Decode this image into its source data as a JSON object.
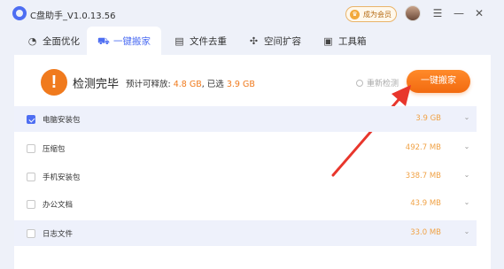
{
  "app": {
    "title": "C盘助手_V1.0.13.56",
    "vip_label": "成为会员"
  },
  "window_controls": {
    "menu_icon": "menu-icon",
    "minimize_icon": "minimize-icon",
    "close_icon": "close-icon"
  },
  "tabs": [
    {
      "label": "全面优化",
      "icon": "gauge-icon",
      "active": false
    },
    {
      "label": "一键搬家",
      "icon": "truck-icon",
      "active": true
    },
    {
      "label": "文件去重",
      "icon": "file-icon",
      "active": false
    },
    {
      "label": "空间扩容",
      "icon": "expand-icon",
      "active": false
    },
    {
      "label": "工具箱",
      "icon": "toolbox-icon",
      "active": false
    }
  ],
  "status": {
    "title": "检测完毕",
    "pre_label": "预计可释放:",
    "releasable": "4.8 GB",
    "selected_label": "已选",
    "selected": "3.9 GB",
    "rescan_label": "重新检测",
    "action_label": "一键搬家"
  },
  "items": [
    {
      "label": "电脑安装包",
      "size": "3.9 GB",
      "checked": true
    },
    {
      "label": "压缩包",
      "size": "492.7 MB",
      "checked": false
    },
    {
      "label": "手机安装包",
      "size": "338.7 MB",
      "checked": false
    },
    {
      "label": "办公文档",
      "size": "43.9 MB",
      "checked": false
    },
    {
      "label": "日志文件",
      "size": "33.0 MB",
      "checked": false
    }
  ],
  "colors": {
    "accent": "#4e6ef2",
    "orange": "#f07a1d",
    "arrow": "#e8362c"
  }
}
